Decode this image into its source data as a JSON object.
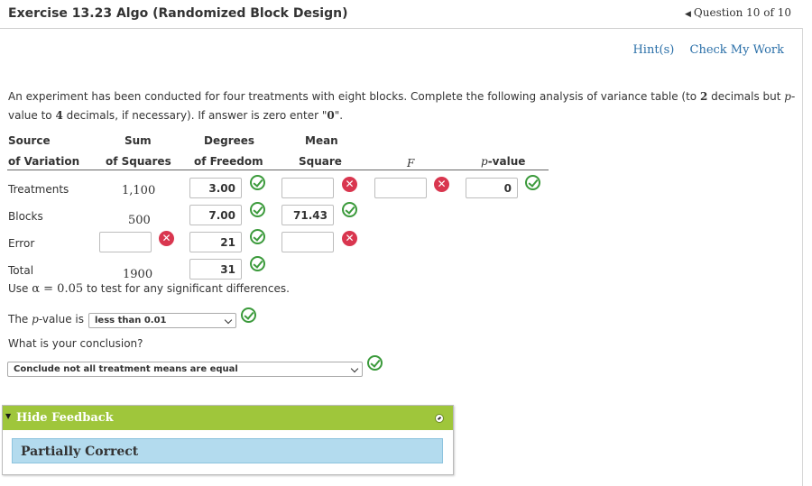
{
  "header": {
    "title": "Exercise 13.23 Algo (Randomized Block Design)",
    "question_nav": "Question 10 of 10"
  },
  "links": {
    "hints": "Hint(s)",
    "check": "Check My Work"
  },
  "prompt": {
    "line1_a": "An experiment has been conducted for four treatments with eight blocks. Complete the following analysis of variance table (to ",
    "decimals_1": "2",
    "line1_b": " decimals but ",
    "p_word": "p",
    "line1_c": "-",
    "line2_a": "value to ",
    "decimals_2": "4",
    "line2_b": " decimals, if necessary). If answer is zero enter \"",
    "zero": "0",
    "line2_c": "\"."
  },
  "table": {
    "headers": {
      "source_1": "Source",
      "source_2": "of Variation",
      "sum_1": "Sum",
      "sum_2": "of Squares",
      "df_1": "Degrees",
      "df_2": "of Freedom",
      "ms_1": "Mean",
      "ms_2": "Square",
      "f": "F",
      "p_italic": "p",
      "p_rest": "-value"
    },
    "rows": {
      "treatments": {
        "label": "Treatments",
        "ss": "1,100",
        "df": "3.00",
        "ms": "",
        "f": "",
        "p": "0"
      },
      "blocks": {
        "label": "Blocks",
        "ss": "500",
        "df": "7.00",
        "ms": "71.43"
      },
      "error": {
        "label": "Error",
        "ss": "",
        "df": "21",
        "ms": ""
      },
      "total": {
        "label": "Total",
        "ss": "1900",
        "df": "31"
      }
    }
  },
  "alpha_line": {
    "prefix": "Use ",
    "math": "α = 0.05",
    "suffix": " to test for any significant differences."
  },
  "pvalue_question": {
    "prefix": "The ",
    "p": "p",
    "suffix": "-value is",
    "selected": "less than 0.01"
  },
  "conclusion": {
    "question": "What is your conclusion?",
    "selected": "Conclude not all treatment means are equal"
  },
  "feedback": {
    "toggle_label": "Hide Feedback",
    "status": "Partially Correct"
  },
  "colors": {
    "correct": "#3b9a3b",
    "incorrect": "#d9364f",
    "feedback_header": "#9fc63b",
    "feedback_body": "#b3dbee",
    "link": "#2a6fa8"
  }
}
